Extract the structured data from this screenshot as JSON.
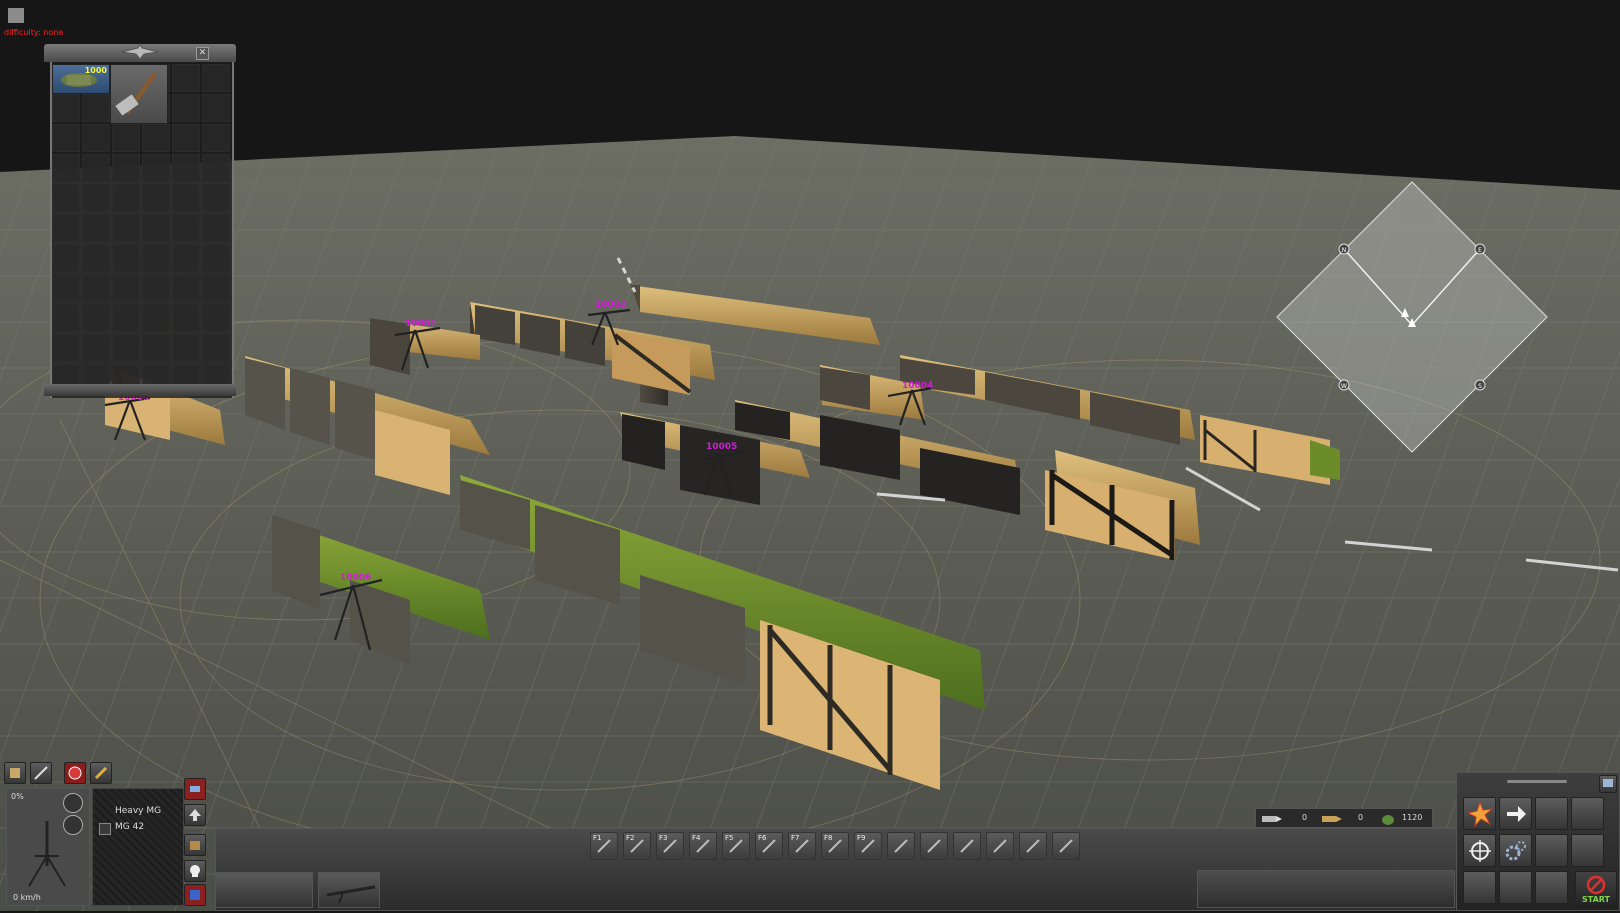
{
  "debug": {
    "difficulty_label": "difficulty: none"
  },
  "inventory": {
    "slot_count": "1000",
    "items": [
      "ammo-box-icon",
      "sledgehammer-icon"
    ]
  },
  "map_labels": [
    "10001",
    "10002",
    "10003",
    "10004",
    "10005",
    "10006"
  ],
  "compass": {
    "north": "N",
    "east": "E",
    "west": "W",
    "south": "S"
  },
  "unit": {
    "health": "0%",
    "speed": "0 km/h",
    "type": "Heavy MG",
    "weapon": "MG 42"
  },
  "hotbar": {
    "keys": [
      "F1",
      "F2",
      "F3",
      "F4",
      "F5",
      "F6",
      "F7",
      "F8",
      "F9",
      "",
      "",
      "",
      "",
      "",
      ""
    ]
  },
  "ammo": {
    "primary": "0",
    "secondary": "0",
    "grenades": "1120"
  },
  "actions": {
    "start_label": "START"
  },
  "colors": {
    "tag": "#d21bd6",
    "debug": "#ff2020",
    "count": "#f4f43a"
  }
}
